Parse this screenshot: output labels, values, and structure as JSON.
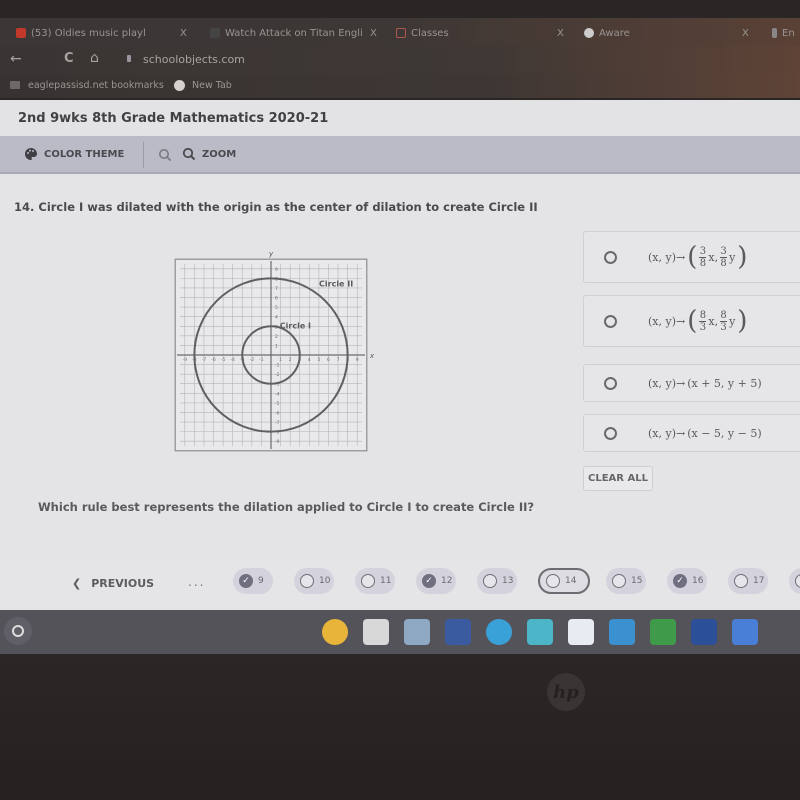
{
  "browser": {
    "tabs": [
      {
        "label": "(53) Oldies music playl",
        "icon": "youtube-icon"
      },
      {
        "label": "Watch Attack on Titan Engli",
        "icon": "video-icon"
      },
      {
        "label": "Classes",
        "icon": "classroom-icon"
      },
      {
        "label": "Aware",
        "icon": "globe-icon"
      },
      {
        "label": "En",
        "icon": "page-icon"
      }
    ],
    "tab_close": "X",
    "url": "schoolobjects.com",
    "bookmarks": [
      {
        "label": "eaglepassisd.net bookmarks",
        "icon": "folder-icon"
      },
      {
        "label": "New Tab",
        "icon": "globe-icon"
      }
    ]
  },
  "course_title": "2nd 9wks 8th Grade Mathematics 2020-21",
  "toolbar": {
    "color_theme_label": "COLOR THEME",
    "zoom_label": "ZOOM"
  },
  "question": {
    "number": "14.",
    "text": "14. Circle I was dilated with the origin as the center of dilation to create Circle II",
    "prompt": "Which rule best represents the dilation applied to Circle I to create Circle II?",
    "graph": {
      "x_label": "x",
      "y_label": "y",
      "range": [
        -9,
        9
      ],
      "circles": [
        {
          "label": "Circle I",
          "center": [
            0,
            0
          ],
          "radius": 3
        },
        {
          "label": "Circle II",
          "center": [
            0,
            0
          ],
          "radius": 8
        }
      ]
    },
    "choices": [
      {
        "lhs": "(x, y)→",
        "kind": "fraction",
        "num": "3",
        "den": "8",
        "selected": false
      },
      {
        "lhs": "(x, y)→",
        "kind": "fraction",
        "num": "8",
        "den": "3",
        "selected": false
      },
      {
        "lhs": "(x, y)→",
        "kind": "text",
        "rhs": "(x + 5, y + 5)",
        "selected": false
      },
      {
        "lhs": "(x, y)→",
        "kind": "text",
        "rhs": "(x − 5, y − 5)",
        "selected": false
      }
    ],
    "clear_all_label": "CLEAR ALL"
  },
  "nav": {
    "previous_label": "PREVIOUS",
    "ellipsis": "...",
    "items": [
      {
        "n": "9",
        "answered": true
      },
      {
        "n": "10",
        "answered": false
      },
      {
        "n": "11",
        "answered": false
      },
      {
        "n": "12",
        "answered": true
      },
      {
        "n": "13",
        "answered": false
      },
      {
        "n": "14",
        "answered": false,
        "current": true
      },
      {
        "n": "15",
        "answered": false
      },
      {
        "n": "16",
        "answered": true
      },
      {
        "n": "17",
        "answered": false
      }
    ]
  },
  "shelf": {
    "apps": [
      "chrome-icon",
      "files-icon",
      "calculator-icon",
      "game-icon",
      "eye-icon",
      "voice-icon",
      "pearson-icon",
      "chat-icon",
      "classroom-icon",
      "texas-icon",
      "docs-icon"
    ]
  },
  "device_logo": "hp"
}
